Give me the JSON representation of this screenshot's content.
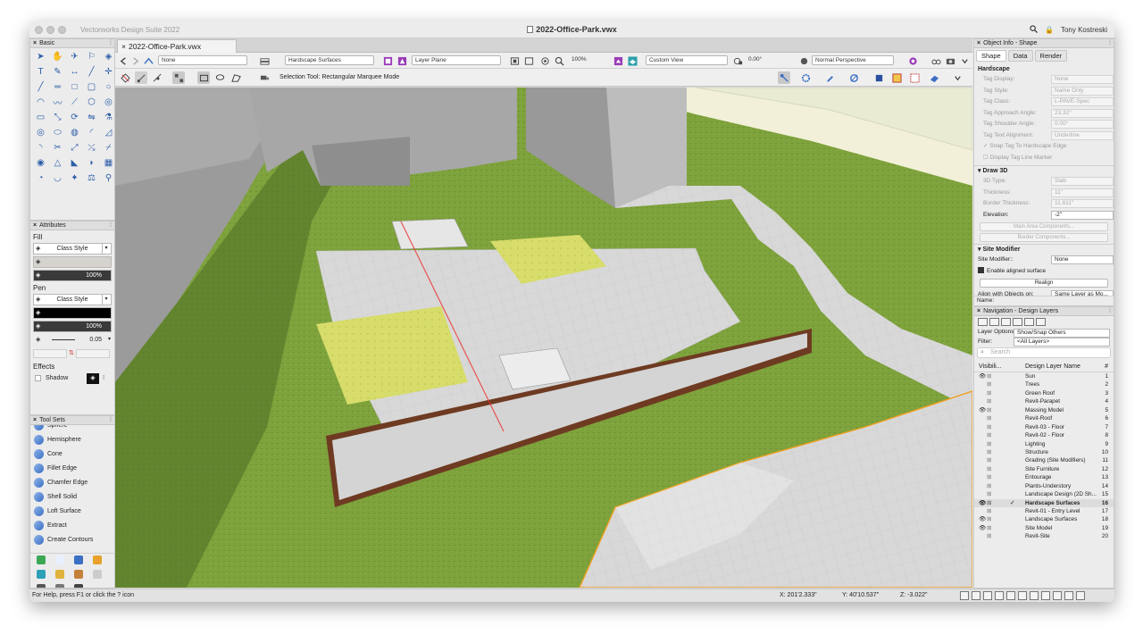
{
  "app": {
    "name": "Vectorworks Design Suite 2022",
    "document_title": "2022-Office-Park.vwx",
    "user": "Tony Kostreski"
  },
  "tab": {
    "label": "2022-Office-Park.vwx",
    "close": "×"
  },
  "toolbar1": {
    "class_select": "None",
    "layer_select": "Hardscape Surfaces",
    "plane_select": "Layer Plane",
    "zoom": "100%",
    "view_select": "Custom View",
    "rotation": "0.00°",
    "render_select": "Normal Perspective"
  },
  "toolbar2": {
    "mode_text": "Selection Tool: Rectangular Marquee Mode"
  },
  "basic_palette": {
    "title": "Basic"
  },
  "attributes": {
    "title": "Attributes",
    "fill_label": "Fill",
    "fill_style": "Class Style",
    "fill_opacity": "100%",
    "pen_label": "Pen",
    "pen_style": "Class Style",
    "pen_opacity": "100%",
    "pen_thickness": "0.05",
    "effects_label": "Effects",
    "shadow_label": "Shadow"
  },
  "toolsets": {
    "title": "Tool Sets",
    "items": [
      {
        "label": "Sphere"
      },
      {
        "label": "Hemisphere"
      },
      {
        "label": "Cone"
      },
      {
        "label": "Fillet Edge"
      },
      {
        "label": "Chamfer Edge"
      },
      {
        "label": "Shell Solid"
      },
      {
        "label": "Loft Surface"
      },
      {
        "label": "Extract"
      },
      {
        "label": "Create Contours"
      }
    ]
  },
  "object_info": {
    "title": "Object Info - Shape",
    "tabs": [
      "Shape",
      "Data",
      "Render"
    ],
    "object_type": "Hardscape",
    "tag_rows": [
      {
        "label": "Tag Display:",
        "value": "None"
      },
      {
        "label": "Tag Style:",
        "value": "Name Only"
      },
      {
        "label": "Tag Class:",
        "value": "L-PAVE-Spec"
      },
      {
        "label": "Tag Approach Angle:",
        "value": "23.32°"
      },
      {
        "label": "Tag Shoulder Angle:",
        "value": "0.00°"
      },
      {
        "label": "Tag Text Alignment:",
        "value": "Underline"
      }
    ],
    "snap_tag": "Snap Tag To Hardscape Edge",
    "display_tag_marker": "Display Tag Line Marker",
    "draw3d_label": "Draw 3D",
    "draw3d_rows": [
      {
        "label": "3D Type:",
        "value": "Slab"
      },
      {
        "label": "Thickness:",
        "value": "11\""
      },
      {
        "label": "Border Thickness:",
        "value": "11.811\""
      },
      {
        "label": "Elevation:",
        "value": "-2\""
      }
    ],
    "main_area_components": "Main Area Components...",
    "border_components": "Border Components...",
    "site_modifier_label": "Site Modifier",
    "site_modifier_row": {
      "label": "Site Modifier::",
      "value": "None"
    },
    "enable_aligned": "Enable aligned surface",
    "realign": "Realign",
    "align_with": "Align with Objects on:",
    "align_value": "Same Layer as Mo...",
    "name_label": "Name:"
  },
  "navigation": {
    "title": "Navigation - Design Layers",
    "layer_options_label": "Layer Options:",
    "layer_options_value": "Show/Snap Others",
    "filter_label": "Filter:",
    "filter_value": "<All Layers>",
    "search_placeholder": "Search",
    "col_visibility": "Visibili...",
    "col_name": "Design Layer Name",
    "col_number": "#",
    "layers": [
      {
        "name": "Sun",
        "number": "1",
        "visible": true
      },
      {
        "name": "Trees",
        "number": "2",
        "visible": false
      },
      {
        "name": "Green Roof",
        "number": "3",
        "visible": false
      },
      {
        "name": "Revit-Parapet",
        "number": "4",
        "visible": false
      },
      {
        "name": "Massing Model",
        "number": "5",
        "visible": true
      },
      {
        "name": "Revit-Roof",
        "number": "6",
        "visible": false
      },
      {
        "name": "Revit-03 - Floor",
        "number": "7",
        "visible": false
      },
      {
        "name": "Revit-02 - Floor",
        "number": "8",
        "visible": false
      },
      {
        "name": "Lighting",
        "number": "9",
        "visible": false
      },
      {
        "name": "Structure",
        "number": "10",
        "visible": false
      },
      {
        "name": "Grading (Site Modifiers)",
        "number": "11",
        "visible": false
      },
      {
        "name": "Site Furniture",
        "number": "12",
        "visible": false
      },
      {
        "name": "Entourage",
        "number": "13",
        "visible": false
      },
      {
        "name": "Plants-Understory",
        "number": "14",
        "visible": false
      },
      {
        "name": "Landscape Design (2D Sh...",
        "number": "15",
        "visible": false
      },
      {
        "name": "Hardscape Surfaces",
        "number": "16",
        "visible": true,
        "active": true
      },
      {
        "name": "Revit-01 - Entry Level",
        "number": "17",
        "visible": false
      },
      {
        "name": "Landscape Surfaces",
        "number": "18",
        "visible": true
      },
      {
        "name": "Site Model",
        "number": "19",
        "visible": true
      },
      {
        "name": "Revit-Site",
        "number": "20",
        "visible": false
      }
    ]
  },
  "status": {
    "help": "For Help, press F1 or click the ? icon",
    "x": "X: 201'2.333\"",
    "y": "Y: 40'10.537\"",
    "z": "Z: -3.022\""
  },
  "colors": {
    "grass": "#7da13a",
    "paving": "#d9d9d9",
    "planter_border": "#6e3b22",
    "selection": "#f0a020",
    "building": "#9a9a9a"
  }
}
